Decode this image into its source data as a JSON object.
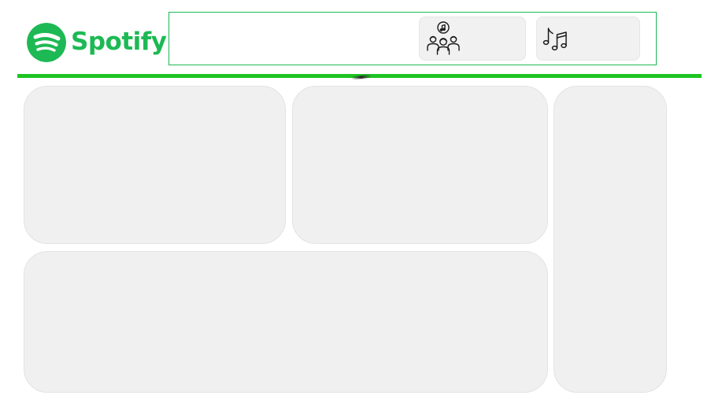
{
  "header": {
    "brand_name": "Spotify",
    "brand_color": "#1db954",
    "toolbar_border_color": "#1db954",
    "divider_color": "#1ec423",
    "buttons": [
      {
        "icon": "group-listening-icon"
      },
      {
        "icon": "music-notes-icon"
      }
    ]
  },
  "panels": [
    {
      "name": "top-left-panel",
      "content": ""
    },
    {
      "name": "top-middle-panel",
      "content": ""
    },
    {
      "name": "right-sidebar-panel",
      "content": ""
    },
    {
      "name": "bottom-wide-panel",
      "content": ""
    }
  ]
}
